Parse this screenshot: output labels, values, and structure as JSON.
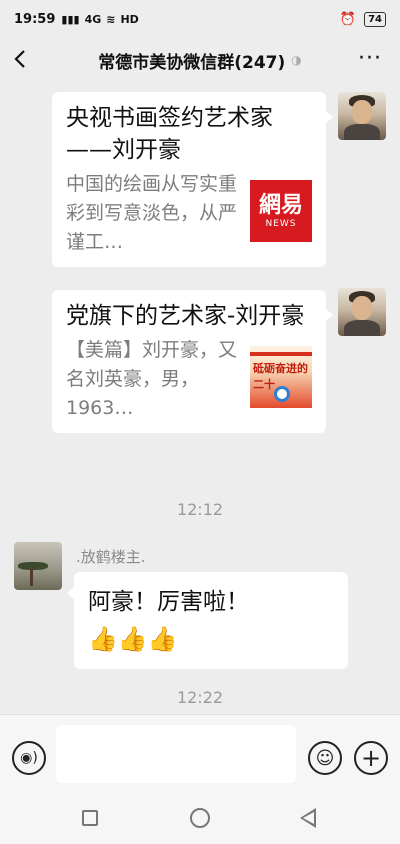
{
  "status_bar": {
    "time": "19:59",
    "signal_text": "4G",
    "network_text": "HD",
    "battery": "74"
  },
  "header": {
    "title": "常德市美协微信群(247)",
    "mute_icon": "speaker-muted-icon",
    "more_label": "···"
  },
  "messages": [
    {
      "type": "link-card",
      "title": "央视书画签约艺术家——刘开豪",
      "description": "中国的绘画从写实重彩到写意淡色，从严谨工…",
      "thumb": "網易",
      "thumb_sub": "NEWS"
    },
    {
      "type": "link-card",
      "title": "党旗下的艺术家-刘开豪",
      "description": "【美篇】刘开豪，又名刘英豪，男，1963…",
      "thumb": "砥砺奋进的二十"
    }
  ],
  "timestamps": [
    "12:12",
    "12:22"
  ],
  "incoming": {
    "sender": ".放鹤楼主.",
    "text": "阿豪！厉害啦！",
    "emoji": "👍👍👍"
  },
  "input_bar": {
    "voice_icon": "voice-icon",
    "emoji_icon": "☺",
    "plus_icon": "+"
  }
}
